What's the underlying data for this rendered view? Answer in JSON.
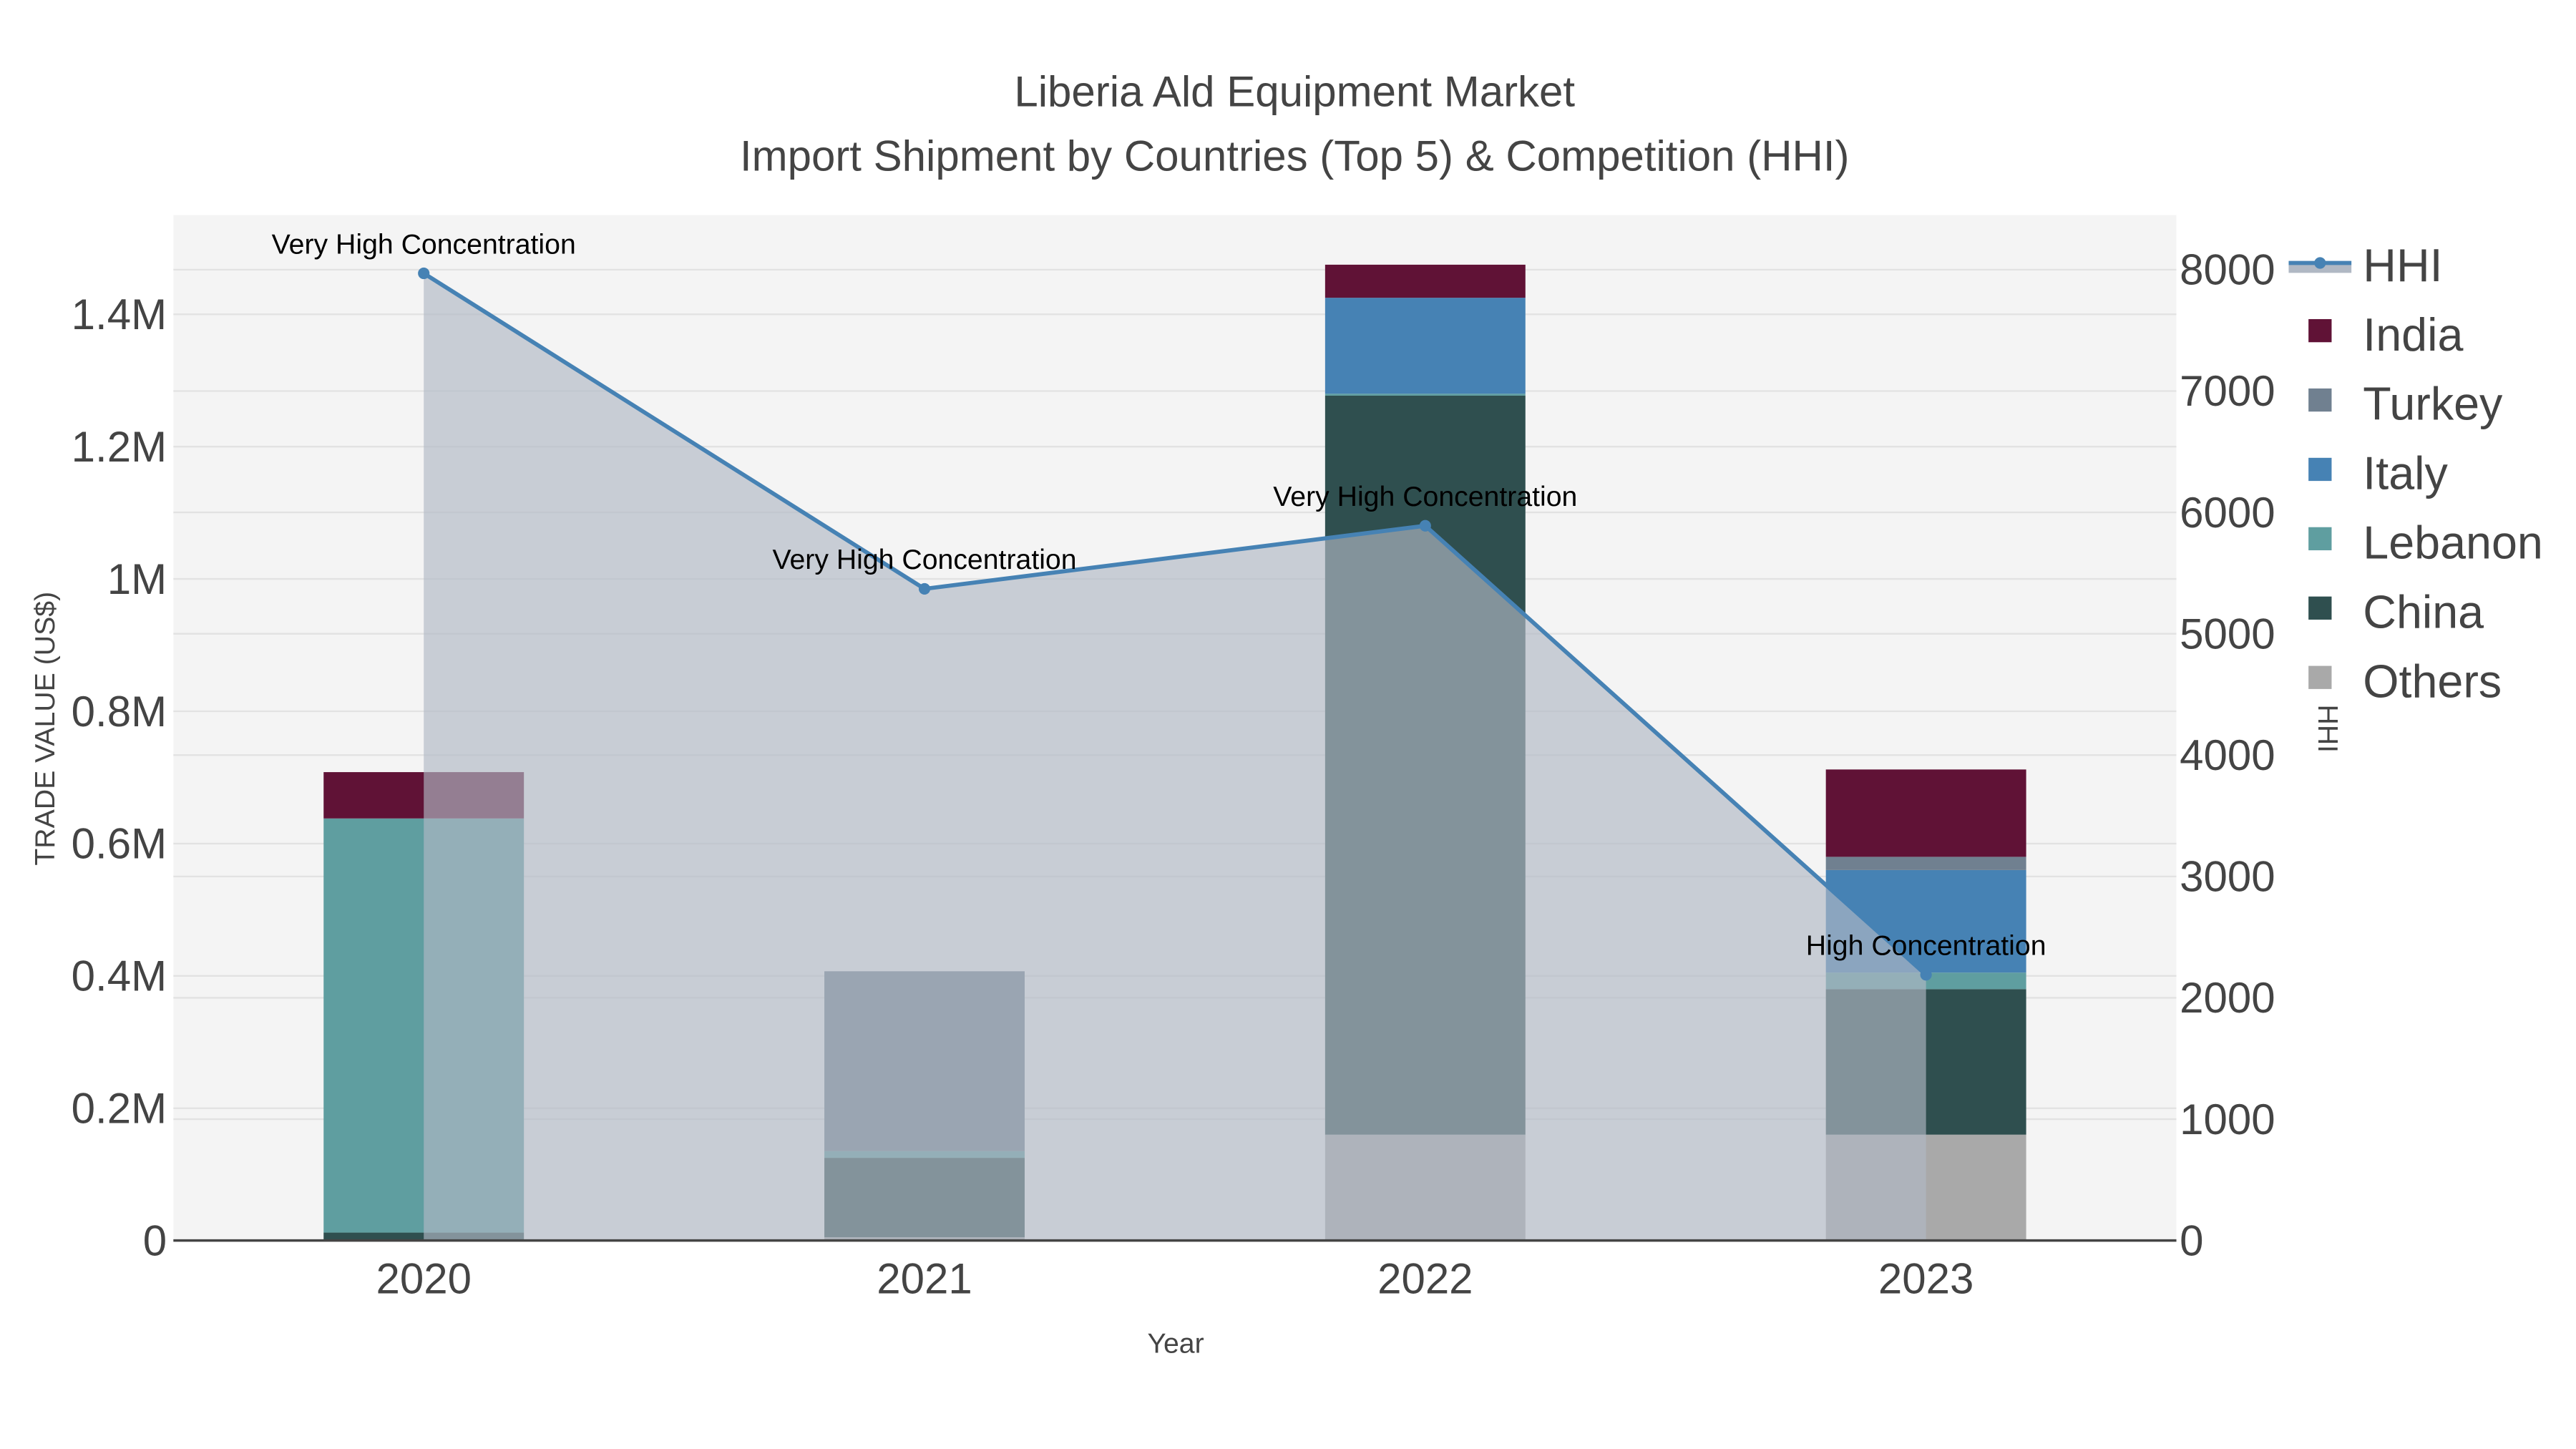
{
  "chart_data": {
    "type": "bar",
    "title": "Liberia Ald Equipment Market",
    "subtitle": "Import Shipment by Countries (Top 5) & Competition (HHI)",
    "xlabel": "Year",
    "ylabel": "TRADE VALUE (US$)",
    "y2label": "HHI",
    "categories": [
      "2020",
      "2021",
      "2022",
      "2023"
    ],
    "ylim": [
      0,
      1550000
    ],
    "y2lim": [
      0,
      8450
    ],
    "yticks": [
      0,
      200000,
      400000,
      600000,
      800000,
      1000000,
      1200000,
      1400000
    ],
    "ytick_labels": [
      "0",
      "0.2M",
      "0.4M",
      "0.6M",
      "0.8M",
      "1M",
      "1.2M",
      "1.4M"
    ],
    "y2ticks": [
      0,
      1000,
      2000,
      3000,
      4000,
      5000,
      6000,
      7000,
      8000
    ],
    "y2tick_labels": [
      "0",
      "1000",
      "2000",
      "3000",
      "4000",
      "5000",
      "6000",
      "7000",
      "8000"
    ],
    "grid": true,
    "barmode": "stack",
    "legend_position": "right",
    "series": [
      {
        "name": "Others",
        "color": "#a9a9a9",
        "values": [
          0,
          5000,
          160000,
          160000
        ]
      },
      {
        "name": "China",
        "color": "#2f4f4f",
        "values": [
          12000,
          120000,
          1117000,
          220000
        ]
      },
      {
        "name": "Lebanon",
        "color": "#5f9ea0",
        "values": [
          626000,
          10000,
          3000,
          25000
        ]
      },
      {
        "name": "Italy",
        "color": "#4682b4",
        "values": [
          0,
          0,
          145000,
          155000
        ]
      },
      {
        "name": "Turkey",
        "color": "#708090",
        "values": [
          0,
          272000,
          0,
          20000
        ]
      },
      {
        "name": "India",
        "color": "#601236",
        "values": [
          70000,
          0,
          50000,
          132000
        ]
      }
    ],
    "line": {
      "name": "HHI",
      "color": "#4682b4",
      "fill_color": "#b0b8c4",
      "values": [
        7970,
        5370,
        5890,
        2190
      ],
      "annotations": [
        "Very High Concentration",
        "Very High Concentration",
        "Very High Concentration",
        "High Concentration"
      ]
    },
    "legend_order": [
      "HHI",
      "India",
      "Turkey",
      "Italy",
      "Lebanon",
      "China",
      "Others"
    ]
  }
}
